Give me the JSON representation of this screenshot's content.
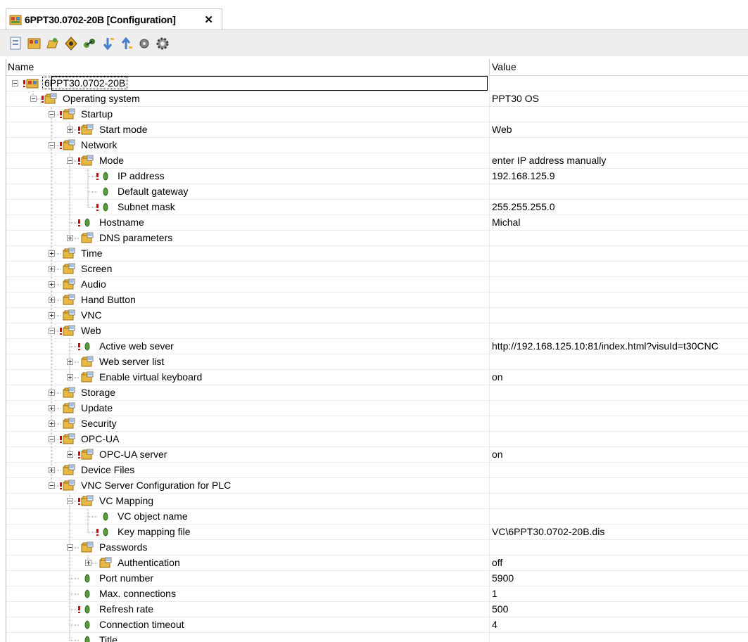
{
  "tab": {
    "title": "6PPT30.0702-20B [Configuration]",
    "close": "✕"
  },
  "toolbar": {
    "buttons": [
      {
        "name": "properties-icon"
      },
      {
        "name": "hardware-icon"
      },
      {
        "name": "open-icon"
      },
      {
        "name": "navigate-icon"
      },
      {
        "name": "connect-icon"
      },
      {
        "name": "sort-desc-icon"
      },
      {
        "name": "sort-asc-icon"
      },
      {
        "name": "record-icon"
      },
      {
        "name": "settings-icon"
      }
    ]
  },
  "columns": {
    "name": "Name",
    "value": "Value"
  },
  "colors": {
    "error": "#e00000",
    "leaf": "#5a9c3a",
    "folder": "#e7b842",
    "root": "#c94a2a"
  },
  "rows": [
    {
      "label": "6PPT30.0702-20B",
      "value": "",
      "level": 0,
      "exp": "minus",
      "err": true,
      "icon": "root",
      "sel": true
    },
    {
      "label": "Operating system",
      "value": "PPT30 OS",
      "level": 1,
      "exp": "minus",
      "err": true,
      "icon": "folder"
    },
    {
      "label": "Startup",
      "value": "",
      "level": 2,
      "exp": "minus",
      "err": true,
      "icon": "folder"
    },
    {
      "label": "Start mode",
      "value": "Web",
      "level": 3,
      "exp": "plus",
      "err": true,
      "icon": "folder"
    },
    {
      "label": "Network",
      "value": "",
      "level": 2,
      "exp": "minus",
      "err": true,
      "icon": "folder"
    },
    {
      "label": "Mode",
      "value": "enter IP address manually",
      "level": 3,
      "exp": "minus",
      "err": true,
      "icon": "folder"
    },
    {
      "label": "IP address",
      "value": "192.168.125.9",
      "level": 4,
      "exp": "",
      "err": true,
      "icon": "leaf"
    },
    {
      "label": "Default gateway",
      "value": "",
      "level": 4,
      "exp": "",
      "err": false,
      "icon": "leaf"
    },
    {
      "label": "Subnet mask",
      "value": "255.255.255.0",
      "level": 4,
      "exp": "",
      "err": true,
      "icon": "leaf"
    },
    {
      "label": "Hostname",
      "value": "Michal",
      "level": 3,
      "exp": "",
      "err": true,
      "icon": "leaf"
    },
    {
      "label": "DNS parameters",
      "value": "",
      "level": 3,
      "exp": "plus",
      "err": false,
      "icon": "folder"
    },
    {
      "label": "Time",
      "value": "",
      "level": 2,
      "exp": "plus",
      "err": false,
      "icon": "folder"
    },
    {
      "label": "Screen",
      "value": "",
      "level": 2,
      "exp": "plus",
      "err": false,
      "icon": "folder"
    },
    {
      "label": "Audio",
      "value": "",
      "level": 2,
      "exp": "plus",
      "err": false,
      "icon": "folder"
    },
    {
      "label": "Hand Button",
      "value": "",
      "level": 2,
      "exp": "plus",
      "err": false,
      "icon": "folder"
    },
    {
      "label": "VNC",
      "value": "",
      "level": 2,
      "exp": "plus",
      "err": false,
      "icon": "folder"
    },
    {
      "label": "Web",
      "value": "",
      "level": 2,
      "exp": "minus",
      "err": true,
      "icon": "folder"
    },
    {
      "label": "Active web sever",
      "value": "http://192.168.125.10:81/index.html?visuId=t30CNC",
      "level": 3,
      "exp": "",
      "err": true,
      "icon": "leaf"
    },
    {
      "label": "Web server list",
      "value": "",
      "level": 3,
      "exp": "plus",
      "err": false,
      "icon": "folder"
    },
    {
      "label": "Enable virtual keyboard",
      "value": "on",
      "level": 3,
      "exp": "plus",
      "err": false,
      "icon": "folder"
    },
    {
      "label": "Storage",
      "value": "",
      "level": 2,
      "exp": "plus",
      "err": false,
      "icon": "folder"
    },
    {
      "label": "Update",
      "value": "",
      "level": 2,
      "exp": "plus",
      "err": false,
      "icon": "folder"
    },
    {
      "label": "Security",
      "value": "",
      "level": 2,
      "exp": "plus",
      "err": false,
      "icon": "folder"
    },
    {
      "label": "OPC-UA",
      "value": "",
      "level": 2,
      "exp": "minus",
      "err": true,
      "icon": "folder"
    },
    {
      "label": "OPC-UA server",
      "value": "on",
      "level": 3,
      "exp": "plus",
      "err": true,
      "icon": "folder"
    },
    {
      "label": "Device Files",
      "value": "",
      "level": 2,
      "exp": "plus",
      "err": false,
      "icon": "folder"
    },
    {
      "label": "VNC Server Configuration for PLC",
      "value": "",
      "level": 2,
      "exp": "minus",
      "err": true,
      "icon": "folder"
    },
    {
      "label": "VC Mapping",
      "value": "",
      "level": 3,
      "exp": "minus",
      "err": true,
      "icon": "folder"
    },
    {
      "label": "VC object name",
      "value": "",
      "level": 4,
      "exp": "",
      "err": false,
      "icon": "leaf"
    },
    {
      "label": "Key mapping file",
      "value": "VC\\6PPT30.0702-20B.dis",
      "level": 4,
      "exp": "",
      "err": true,
      "icon": "leaf"
    },
    {
      "label": "Passwords",
      "value": "",
      "level": 3,
      "exp": "minus",
      "err": false,
      "icon": "folder"
    },
    {
      "label": "Authentication",
      "value": "off",
      "level": 4,
      "exp": "plus",
      "err": false,
      "icon": "folder"
    },
    {
      "label": "Port number",
      "value": "5900",
      "level": 3,
      "exp": "",
      "err": false,
      "icon": "leaf"
    },
    {
      "label": "Max. connections",
      "value": "1",
      "level": 3,
      "exp": "",
      "err": false,
      "icon": "leaf"
    },
    {
      "label": "Refresh rate",
      "value": "500",
      "level": 3,
      "exp": "",
      "err": true,
      "icon": "leaf"
    },
    {
      "label": "Connection timeout",
      "value": "4",
      "level": 3,
      "exp": "",
      "err": false,
      "icon": "leaf"
    },
    {
      "label": "Title",
      "value": "",
      "level": 3,
      "exp": "",
      "err": false,
      "icon": "leaf"
    }
  ]
}
